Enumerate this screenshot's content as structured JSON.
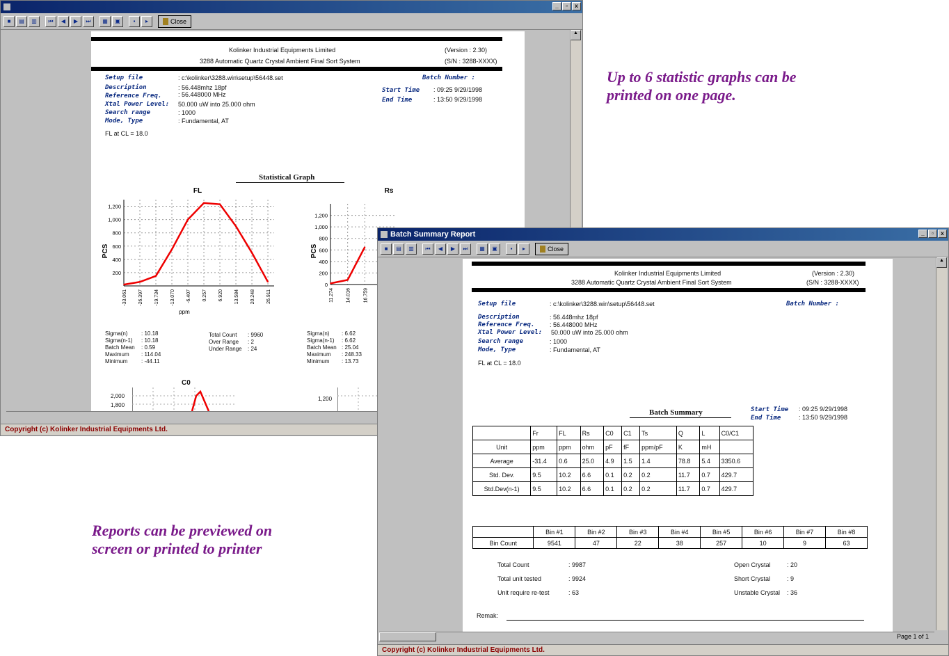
{
  "captions": {
    "graphs": [
      "Up to 6 statistic graphs can be",
      "printed on one page."
    ],
    "preview": [
      "Reports can be previewed on",
      "screen or printed to printer"
    ]
  },
  "window1": {
    "title": "",
    "close_label": "Close",
    "status": "Copyright (c) Kolinker Industrial Equipments Ltd.",
    "report": {
      "company": "Kolinker Industrial Equipments Limited",
      "system": "3288 Automatic Quartz Crystal Ambient Final Sort System",
      "version": "(Version : 2.30)",
      "sn": "(S/N : 3288-XXXX)",
      "fields": [
        {
          "label": "Setup file",
          "value": ": c:\\kolinker\\3288.win\\setup\\56448.set"
        },
        {
          "label": "Description",
          "value": ": 56.448mhz 18pf"
        },
        {
          "label": "Reference Freq.",
          "value": ": 56.448000 MHz"
        },
        {
          "label": "Xtal Power Level:",
          "value": "50.000 uW into 25.000 ohm"
        },
        {
          "label": "Search range",
          "value": ": 1000"
        },
        {
          "label": "Mode, Type",
          "value": ": Fundamental, AT"
        }
      ],
      "fl_at_cl": "FL at CL = 18.0",
      "batch_number_label": "Batch Number :",
      "start_time_label": "Start Time",
      "start_time": ": 09:25  9/29/1998",
      "end_time_label": "End Time",
      "end_time": ": 13:50  9/29/1998",
      "graph_heading": "Statistical Graph",
      "fl_stats_left": [
        [
          "Sigma(n)",
          ": 10.18"
        ],
        [
          "Sigma(n-1)",
          ": 10.18"
        ],
        [
          "Batch Mean",
          ": 0.59"
        ],
        [
          "Maximum",
          ": 114.04"
        ],
        [
          "Minimum",
          ": -44.11"
        ]
      ],
      "fl_stats_right": [
        [
          "Total Count",
          ": 9960"
        ],
        [
          "Over Range",
          ": 2"
        ],
        [
          "Under Range",
          ": 24"
        ]
      ],
      "rs_stats": [
        [
          "Sigma(n)",
          ": 6.62"
        ],
        [
          "Sigma(n-1)",
          ": 6.62"
        ],
        [
          "Batch Mean",
          ": 25.04"
        ],
        [
          "Maximum",
          ": 248.33"
        ],
        [
          "Minimum",
          ": 13.73"
        ]
      ],
      "c0_title": "C0",
      "c0_ticks": [
        "2,000",
        "1,800"
      ],
      "rs_c0_tick": "1,200"
    }
  },
  "window2": {
    "title": "Batch Summary Report",
    "close_label": "Close",
    "status": "Copyright (c) Kolinker Industrial Equipments Ltd.",
    "page_indicator": "Page 1 of 1",
    "report": {
      "company": "Kolinker Industrial Equipments Limited",
      "system": "3288 Automatic Quartz Crystal Ambient Final Sort System",
      "version": "(Version : 2.30)",
      "sn": "(S/N : 3288-XXXX)",
      "fields": [
        {
          "label": "Setup file",
          "value": ": c:\\kolinker\\3288.win\\setup\\56448.set"
        },
        {
          "label": "Description",
          "value": ": 56.448mhz 18pf"
        },
        {
          "label": "Reference Freq.",
          "value": ": 56.448000 MHz"
        },
        {
          "label": "Xtal Power Level:",
          "value": "50.000 uW into 25.000 ohm"
        },
        {
          "label": "Search range",
          "value": ": 1000"
        },
        {
          "label": "Mode, Type",
          "value": ": Fundamental, AT"
        }
      ],
      "fl_at_cl": "FL at CL = 18.0",
      "batch_number_label": "Batch Number :",
      "summary_heading": "Batch Summary",
      "start_time_label": "Start Time",
      "start_time": ": 09:25  9/29/1998",
      "end_time_label": "End Time",
      "end_time": ": 13:50  9/29/1998",
      "stats_table": {
        "headers": [
          "",
          "Fr",
          "FL",
          "Rs",
          "C0",
          "C1",
          "Ts",
          "Q",
          "L",
          "C0/C1"
        ],
        "rows": [
          [
            "Unit",
            "ppm",
            "ppm",
            "ohm",
            "pF",
            "fF",
            "ppm/pF",
            "K",
            "mH",
            ""
          ],
          [
            "Average",
            "-31.4",
            "0.6",
            "25.0",
            "4.9",
            "1.5",
            "1.4",
            "78.8",
            "5.4",
            "3350.6"
          ],
          [
            "Std. Dev.",
            "9.5",
            "10.2",
            "6.6",
            "0.1",
            "0.2",
            "0.2",
            "11.7",
            "0.7",
            "429.7"
          ],
          [
            "Std.Dev(n-1)",
            "9.5",
            "10.2",
            "6.6",
            "0.1",
            "0.2",
            "0.2",
            "11.7",
            "0.7",
            "429.7"
          ]
        ]
      },
      "bin_table": {
        "headers": [
          "",
          "Bin #1",
          "Bin #2",
          "Bin #3",
          "Bin #4",
          "Bin #5",
          "Bin #6",
          "Bin #7",
          "Bin #8"
        ],
        "row": [
          "Bin Count",
          "9541",
          "47",
          "22",
          "38",
          "257",
          "10",
          "9",
          "63"
        ]
      },
      "totals_left": [
        [
          "Total Count",
          ":  9987"
        ],
        [
          "Total unit tested",
          ":  9924"
        ],
        [
          "Unit require re-test",
          ":  63"
        ]
      ],
      "totals_right": [
        [
          "Open Crystal",
          ":  20"
        ],
        [
          "Short Crystal",
          ":  9"
        ],
        [
          "Unstable Crystal",
          ":  36"
        ]
      ],
      "remark_label": "Remak:"
    }
  },
  "chart_data": [
    {
      "type": "line",
      "title": "FL",
      "xlabel": "ppm",
      "ylabel": "PCS",
      "x": [
        -33.061,
        -26.397,
        -19.734,
        -13.07,
        -6.407,
        0.257,
        6.92,
        13.584,
        20.248,
        26.911
      ],
      "values": [
        20,
        60,
        150,
        550,
        1000,
        1250,
        1230,
        900,
        500,
        60
      ],
      "yticks": [
        200,
        400,
        600,
        800,
        1000,
        1200
      ],
      "ylim": [
        0,
        1300
      ],
      "grid": true
    },
    {
      "type": "line",
      "title": "Rs",
      "xlabel": "",
      "ylabel": "PCS",
      "x": [
        11.274,
        14.016,
        16.759
      ],
      "values": [
        20,
        80,
        650
      ],
      "yticks": [
        0,
        200,
        400,
        600,
        800,
        1000,
        1200
      ],
      "ylim": [
        0,
        1400
      ],
      "grid": true
    }
  ]
}
